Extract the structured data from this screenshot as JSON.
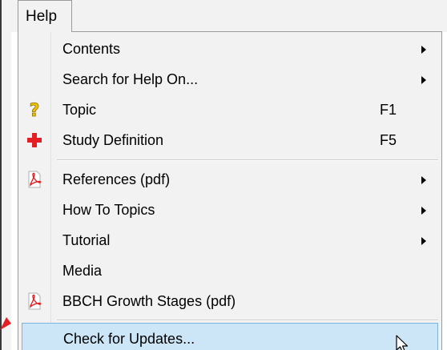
{
  "menu": {
    "title": "Help",
    "items": [
      {
        "label": "Contents",
        "shortcut": "",
        "submenu": true,
        "icon": ""
      },
      {
        "label": "Search for Help On...",
        "shortcut": "",
        "submenu": true,
        "icon": ""
      },
      {
        "label": "Topic",
        "shortcut": "F1",
        "submenu": false,
        "icon": "help-question-icon"
      },
      {
        "label": "Study Definition",
        "shortcut": "F5",
        "submenu": false,
        "icon": "red-cross-icon"
      },
      {
        "label": "References (pdf)",
        "shortcut": "",
        "submenu": true,
        "icon": "pdf-icon"
      },
      {
        "label": "How To Topics",
        "shortcut": "",
        "submenu": true,
        "icon": ""
      },
      {
        "label": "Tutorial",
        "shortcut": "",
        "submenu": true,
        "icon": ""
      },
      {
        "label": "Media",
        "shortcut": "",
        "submenu": false,
        "icon": ""
      },
      {
        "label": "BBCH Growth Stages (pdf)",
        "shortcut": "",
        "submenu": false,
        "icon": "pdf-icon"
      },
      {
        "label": "Check for Updates...",
        "shortcut": "",
        "submenu": false,
        "icon": "",
        "highlighted": true
      }
    ]
  },
  "colors": {
    "menu_background": "#f2f2f2",
    "highlight_background": "#cde6f7",
    "highlight_border": "#7ab4e0",
    "border": "#9a9a9a",
    "icon_red": "#e31e24",
    "icon_yellow": "#f2c500"
  }
}
